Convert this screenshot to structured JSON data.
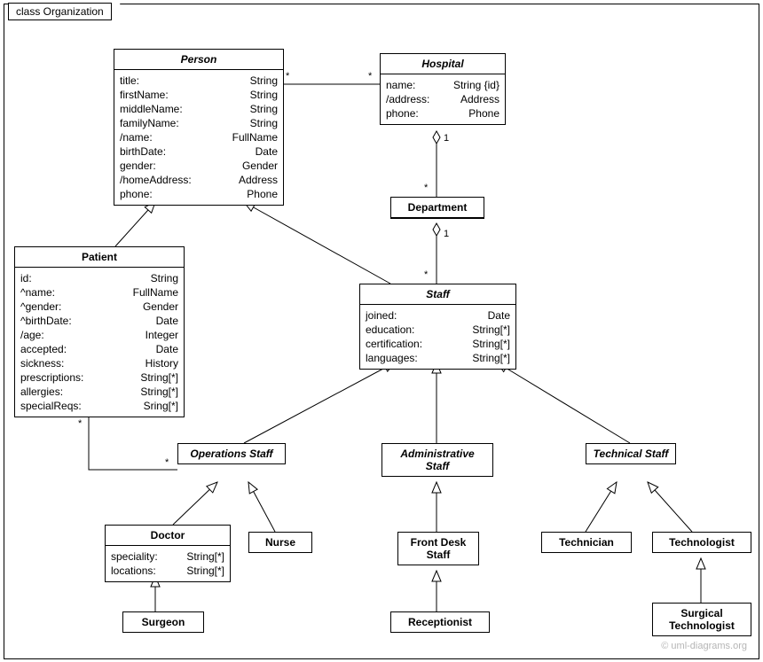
{
  "frame": {
    "title": "class Organization"
  },
  "classes": {
    "person": {
      "name": "Person",
      "attrs": [
        [
          "title:",
          "String"
        ],
        [
          "firstName:",
          "String"
        ],
        [
          "middleName:",
          "String"
        ],
        [
          "familyName:",
          "String"
        ],
        [
          "/name:",
          "FullName"
        ],
        [
          "birthDate:",
          "Date"
        ],
        [
          "gender:",
          "Gender"
        ],
        [
          "/homeAddress:",
          "Address"
        ],
        [
          "phone:",
          "Phone"
        ]
      ]
    },
    "hospital": {
      "name": "Hospital",
      "attrs": [
        [
          "name:",
          "String {id}"
        ],
        [
          "/address:",
          "Address"
        ],
        [
          "phone:",
          "Phone"
        ]
      ]
    },
    "department": {
      "name": "Department"
    },
    "patient": {
      "name": "Patient",
      "attrs": [
        [
          "id:",
          "String"
        ],
        [
          "^name:",
          "FullName"
        ],
        [
          "^gender:",
          "Gender"
        ],
        [
          "^birthDate:",
          "Date"
        ],
        [
          "/age:",
          "Integer"
        ],
        [
          "accepted:",
          "Date"
        ],
        [
          "sickness:",
          "History"
        ],
        [
          "prescriptions:",
          "String[*]"
        ],
        [
          "allergies:",
          "String[*]"
        ],
        [
          "specialReqs:",
          "Sring[*]"
        ]
      ]
    },
    "staff": {
      "name": "Staff",
      "attrs": [
        [
          "joined:",
          "Date"
        ],
        [
          "education:",
          "String[*]"
        ],
        [
          "certification:",
          "String[*]"
        ],
        [
          "languages:",
          "String[*]"
        ]
      ]
    },
    "opsStaff": {
      "name": "Operations Staff"
    },
    "adminStaff": {
      "name": "Administrative Staff"
    },
    "techStaff": {
      "name": "Technical Staff"
    },
    "doctor": {
      "name": "Doctor",
      "attrs": [
        [
          "speciality:",
          "String[*]"
        ],
        [
          "locations:",
          "String[*]"
        ]
      ]
    },
    "nurse": {
      "name": "Nurse"
    },
    "frontDesk": {
      "name": "Front Desk Staff"
    },
    "receptionist": {
      "name": "Receptionist"
    },
    "technician": {
      "name": "Technician"
    },
    "technologist": {
      "name": "Technologist"
    },
    "surgTech": {
      "name": "Surgical Technologist"
    }
  },
  "mult": {
    "star": "*",
    "one": "1"
  },
  "watermark": "© uml-diagrams.org"
}
